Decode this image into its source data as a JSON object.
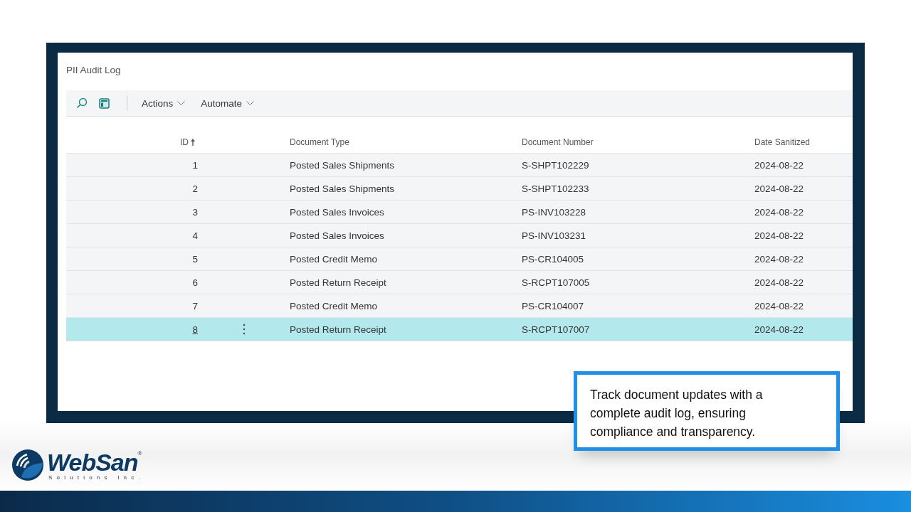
{
  "page": {
    "title": "PII Audit Log"
  },
  "toolbar": {
    "menus": [
      {
        "label": "Actions"
      },
      {
        "label": "Automate"
      }
    ]
  },
  "table": {
    "columns": [
      {
        "label": "ID",
        "sorted": true
      },
      {
        "label": "Document Type",
        "sorted": false
      },
      {
        "label": "Document Number",
        "sorted": false
      },
      {
        "label": "Date Sanitized",
        "sorted": false
      }
    ],
    "rows": [
      {
        "id": "1",
        "document_type": "Posted Sales Shipments",
        "document_number": "S-SHPT102229",
        "date_sanitized": "2024-08-22",
        "selected": false
      },
      {
        "id": "2",
        "document_type": "Posted Sales Shipments",
        "document_number": "S-SHPT102233",
        "date_sanitized": "2024-08-22",
        "selected": false
      },
      {
        "id": "3",
        "document_type": "Posted Sales Invoices",
        "document_number": "PS-INV103228",
        "date_sanitized": "2024-08-22",
        "selected": false
      },
      {
        "id": "4",
        "document_type": "Posted Sales Invoices",
        "document_number": "PS-INV103231",
        "date_sanitized": "2024-08-22",
        "selected": false
      },
      {
        "id": "5",
        "document_type": "Posted Credit Memo",
        "document_number": "PS-CR104005",
        "date_sanitized": "2024-08-22",
        "selected": false
      },
      {
        "id": "6",
        "document_type": "Posted Return Receipt",
        "document_number": "S-RCPT107005",
        "date_sanitized": "2024-08-22",
        "selected": false
      },
      {
        "id": "7",
        "document_type": "Posted Credit Memo",
        "document_number": "PS-CR104007",
        "date_sanitized": "2024-08-22",
        "selected": false
      },
      {
        "id": "8",
        "document_type": "Posted Return Receipt",
        "document_number": "S-RCPT107007",
        "date_sanitized": "2024-08-22",
        "selected": true
      }
    ]
  },
  "callout": {
    "text": "Track document updates with a complete audit log, ensuring compliance and transparency."
  },
  "logo": {
    "name": "WebSan",
    "registered": "®",
    "tagline": "Solutions Inc."
  }
}
